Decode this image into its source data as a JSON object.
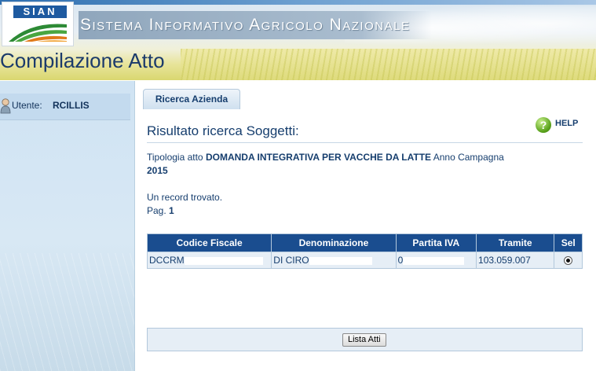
{
  "header": {
    "logo_text": "SIAN",
    "site_title": "Sistema Informativo Agricolo Nazionale",
    "page_title": "Compilazione Atto"
  },
  "sidebar": {
    "user_label": "Utente:",
    "user_name": "RCILLIS"
  },
  "main": {
    "tab_label": "Ricerca Azienda",
    "help_label": "HELP",
    "result_title": "Risultato ricerca Soggetti:",
    "tipologia_prefix": "Tipologia atto",
    "tipologia_value": "DOMANDA INTEGRATIVA PER VACCHE DA LATTE",
    "anno_label": "Anno Campagna",
    "anno_value": "2015",
    "record_text": "Un record trovato.",
    "page_label": "Pag.",
    "page_value": "1"
  },
  "table": {
    "headers": [
      "Codice Fiscale",
      "Denominazione",
      "Partita IVA",
      "Tramite",
      "Sel"
    ],
    "rows": [
      {
        "codice_fiscale": "DCCRM",
        "denominazione": "DI CIRO",
        "partita_iva": "0",
        "tramite": "103.059.007",
        "selected": true
      }
    ]
  },
  "footer": {
    "lista_button": "Lista Atti"
  }
}
